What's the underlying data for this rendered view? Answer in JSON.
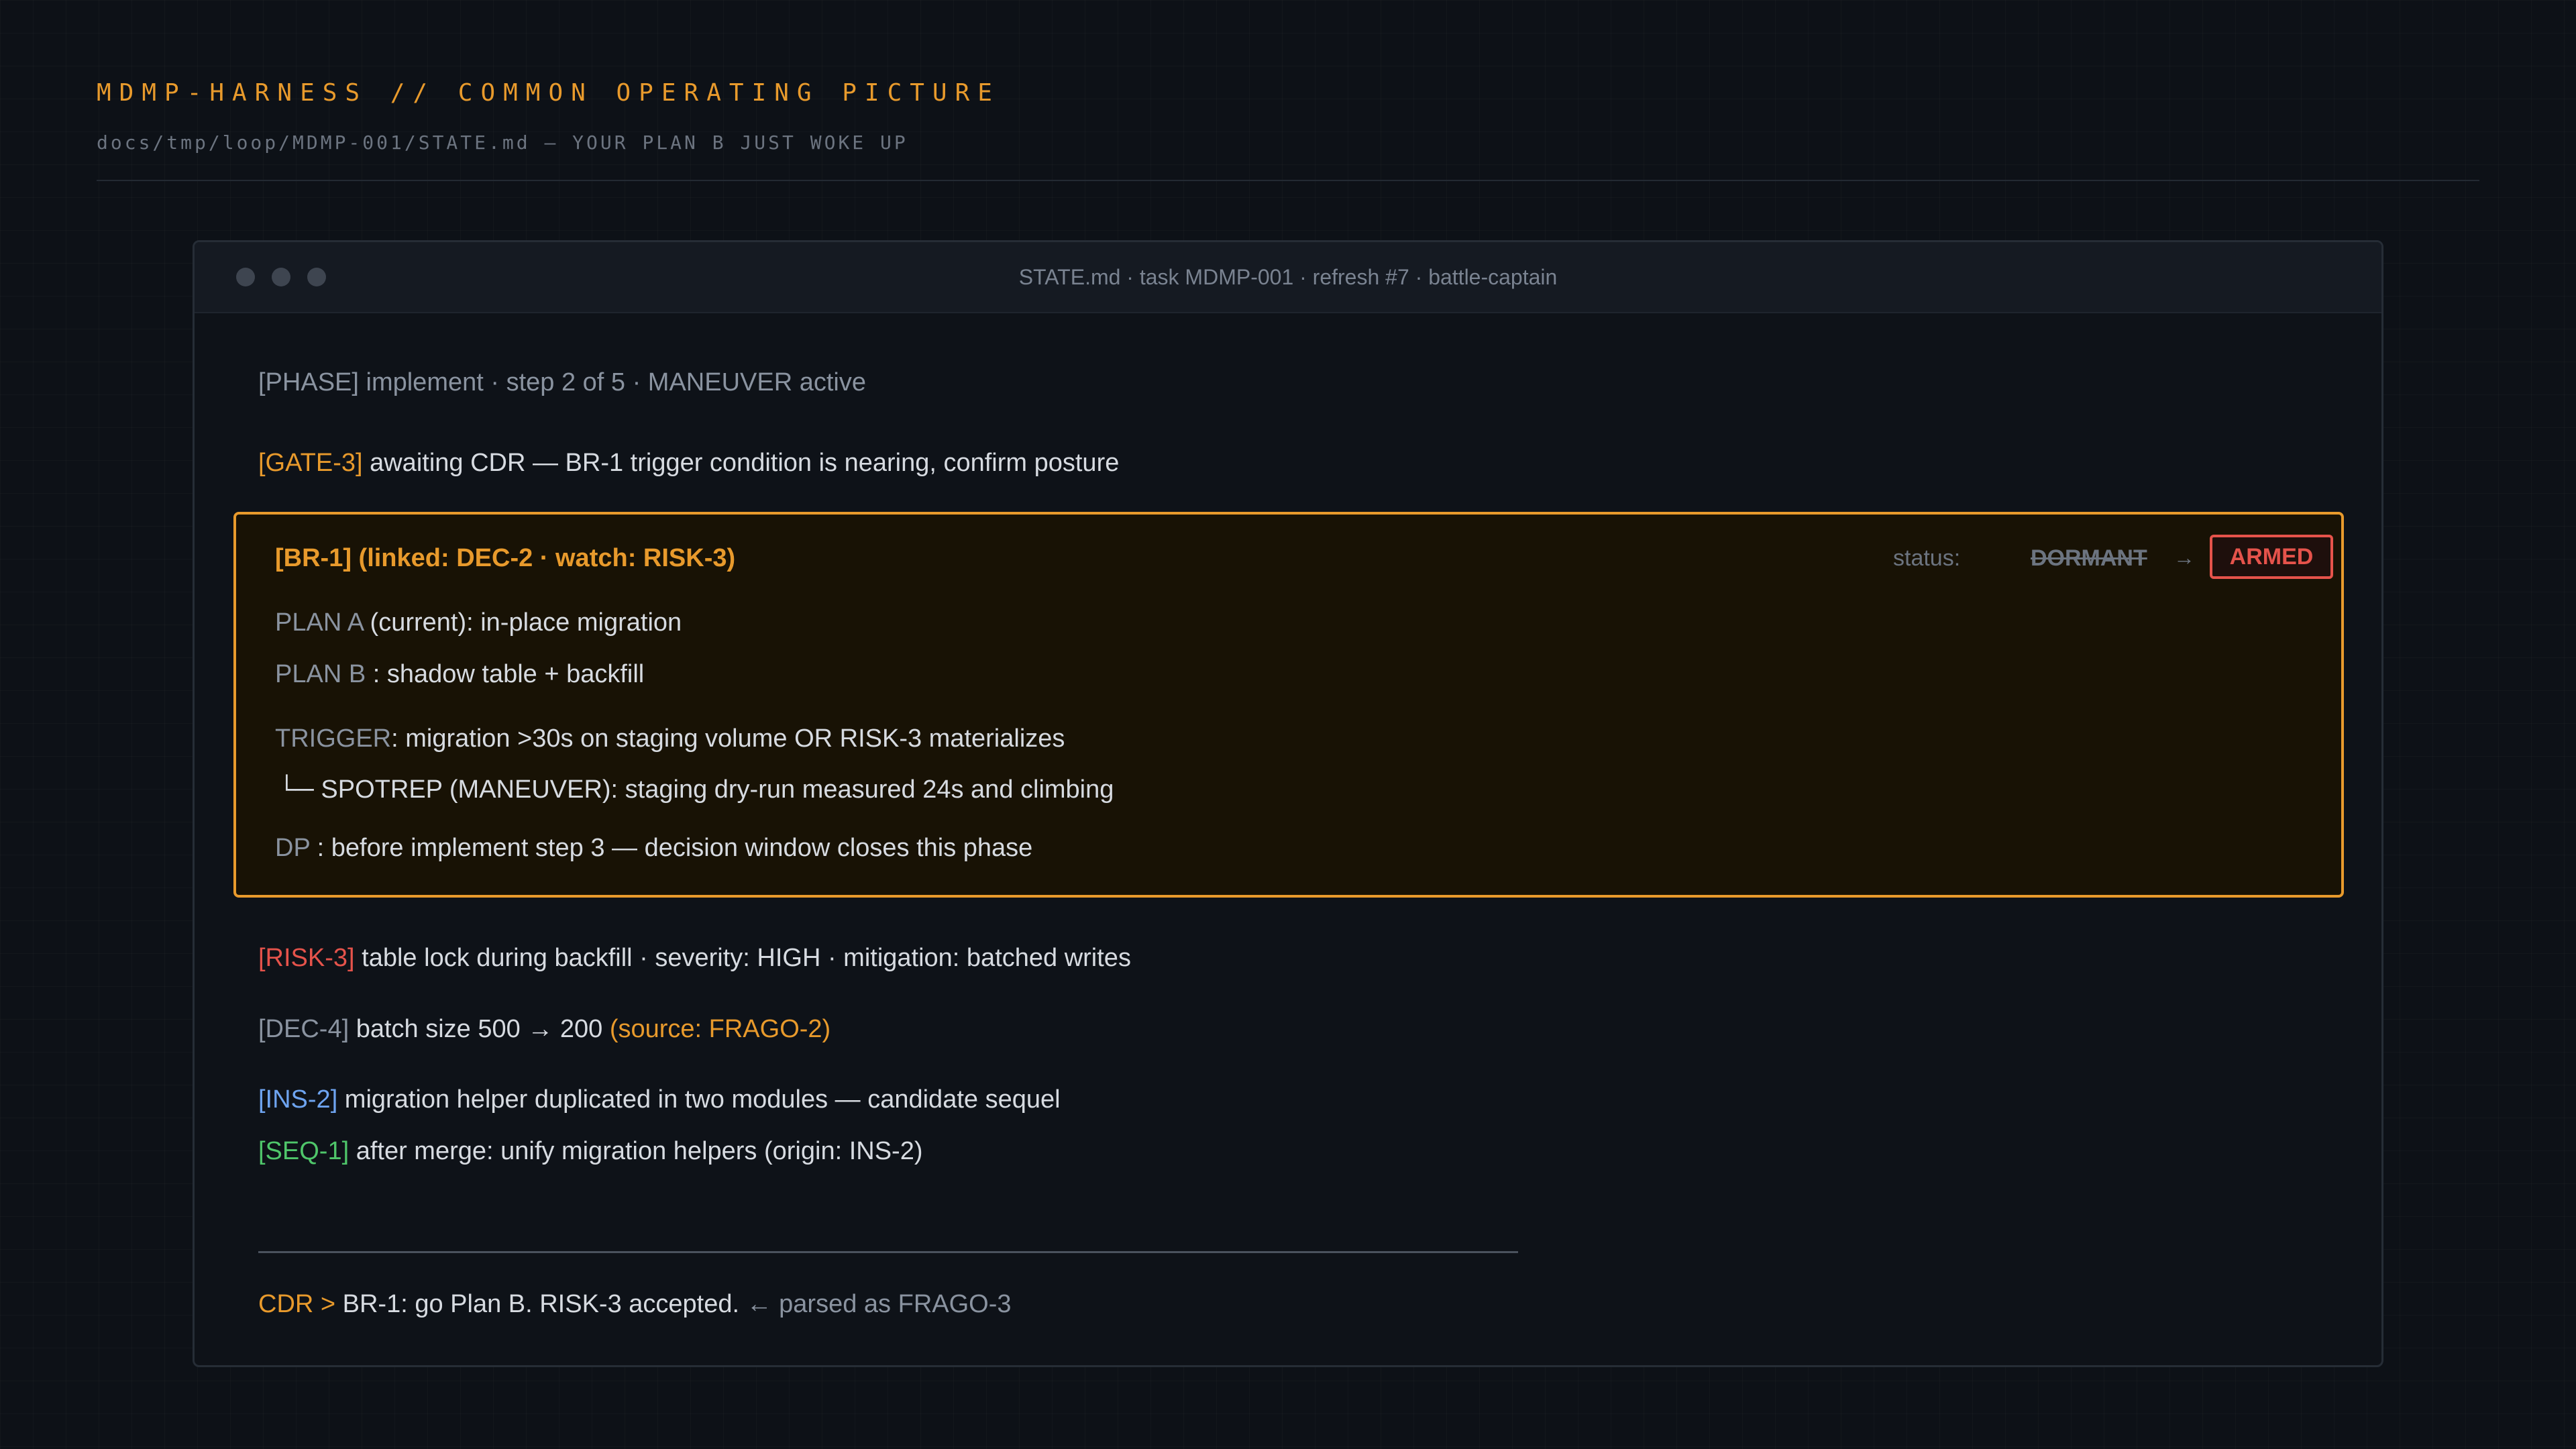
{
  "header": {
    "title": "MDMP-HARNESS // COMMON OPERATING PICTURE",
    "subtitle": "docs/tmp/loop/MDMP-001/STATE.md — YOUR PLAN B JUST WOKE UP"
  },
  "window": {
    "title": "STATE.md · task MDMP-001 · refresh #7 · battle-captain"
  },
  "phase": {
    "tag": "[PHASE]",
    "text": " implement · step 2 of 5 · MANEUVER active"
  },
  "gate": {
    "tag": "[GATE-3]",
    "text": " awaiting CDR — BR-1 trigger condition is nearing, confirm posture"
  },
  "branch": {
    "heading": "[BR-1] (linked: DEC-2 · watch: RISK-3)",
    "status_label": "status:",
    "status_old": "DORMANT",
    "status_arrow": "→",
    "status_new": "ARMED",
    "plan_a_tag": "PLAN A",
    "plan_a_text": " (current): in-place migration",
    "plan_b_tag": "PLAN B",
    "plan_b_text": " : shadow table + backfill",
    "trigger_tag": "TRIGGER",
    "trigger_text": ": migration >30s on staging volume OR RISK-3 materializes",
    "spotrep_prefix": "└─",
    "spotrep_text": "SPOTREP (MANEUVER): staging dry-run measured 24s and climbing",
    "dp_tag": "DP",
    "dp_text": " : before implement step 3 — decision window closes this phase"
  },
  "risk": {
    "tag": "[RISK-3]",
    "text": " table lock during backfill · severity: HIGH · mitigation: batched writes"
  },
  "decision": {
    "tag": "[DEC-4]",
    "text": " batch size 500 → 200 ",
    "source": "(source: FRAGO-2)"
  },
  "insight": {
    "tag": "[INS-2]",
    "text": " migration helper duplicated in two modules — candidate sequel"
  },
  "sequel": {
    "tag": "[SEQ-1]",
    "text": " after merge: unify migration helpers (origin: INS-2)"
  },
  "command": {
    "prompt": "CDR >",
    "text": " BR-1: go Plan B. RISK-3 accepted. ",
    "parsed": "← parsed as FRAGO-3"
  },
  "colors": {
    "accent": "#e89a2c",
    "alert": "#e5534b",
    "info": "#6ea4f0",
    "success": "#4fc66a",
    "background": "#0d1117"
  }
}
